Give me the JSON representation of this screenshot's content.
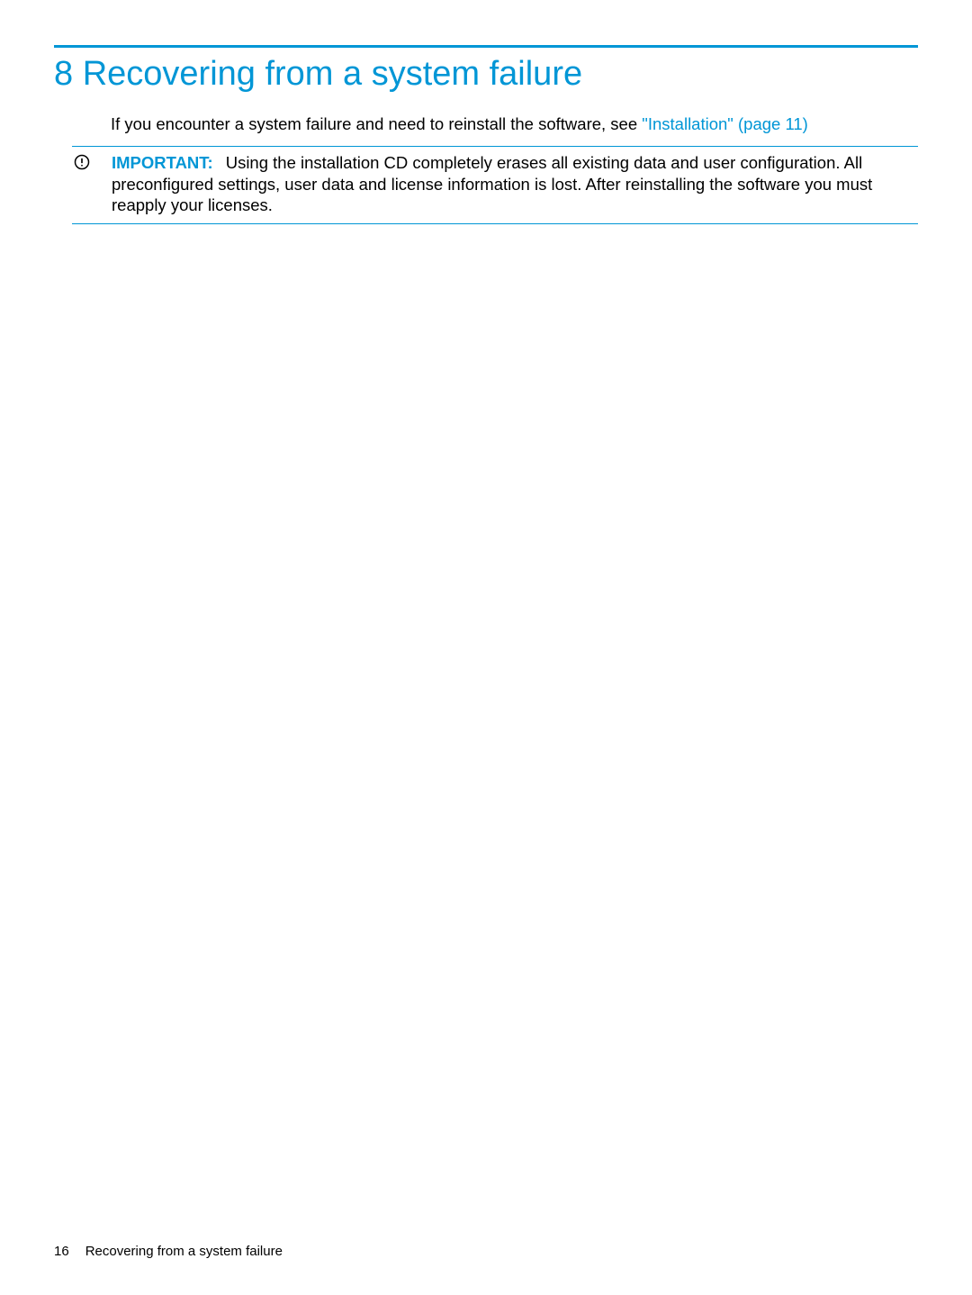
{
  "colors": {
    "accent": "#0096d6"
  },
  "heading": {
    "text": "8 Recovering from a system failure"
  },
  "intro": {
    "prefix": "If you encounter a system failure and need to reinstall the software, see ",
    "link": "\"Installation\" (page 11)"
  },
  "callout": {
    "label": "IMPORTANT:",
    "body": "Using the installation CD completely erases all existing data and user configuration. All preconfigured settings, user data and license information is lost. After reinstalling the software you must reapply your licenses."
  },
  "footer": {
    "page_number": "16",
    "section_title": "Recovering from a system failure"
  }
}
